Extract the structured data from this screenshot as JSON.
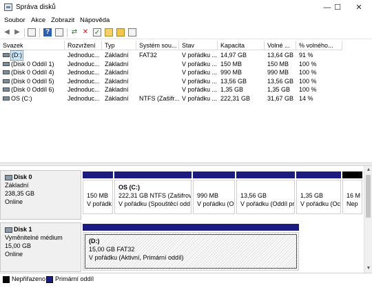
{
  "window": {
    "title": "Správa disků",
    "min": "—",
    "max": "☐",
    "close": "✕"
  },
  "menu": [
    "Soubor",
    "Akce",
    "Zobrazit",
    "Nápověda"
  ],
  "toolbar_icons": [
    "back-arrow-icon",
    "forward-arrow-icon",
    "console-tree-icon",
    "help-icon",
    "properties-icon",
    "connect-icon",
    "delete-icon",
    "check-icon",
    "new-icon",
    "open-folder-icon",
    "details-icon"
  ],
  "columns": [
    "Svazek",
    "Rozvržení",
    "Typ",
    "Systém sou...",
    "Stav",
    "Kapacita",
    "Volné ...",
    "% volného..."
  ],
  "volumes": [
    {
      "name": "(D:)",
      "layout": "Jednoduc...",
      "type": "Základní",
      "fs": "FAT32",
      "status": "V pořádku ...",
      "capacity": "14,97 GB",
      "free": "13,64 GB",
      "pct": "91 %"
    },
    {
      "name": "(Disk 0 Oddíl 1)",
      "layout": "Jednoduc...",
      "type": "Základní",
      "fs": "",
      "status": "V pořádku ...",
      "capacity": "150 MB",
      "free": "150 MB",
      "pct": "100 %"
    },
    {
      "name": "(Disk 0 Oddíl 4)",
      "layout": "Jednoduc...",
      "type": "Základní",
      "fs": "",
      "status": "V pořádku ...",
      "capacity": "990 MB",
      "free": "990 MB",
      "pct": "100 %"
    },
    {
      "name": "(Disk 0 Oddíl 5)",
      "layout": "Jednoduc...",
      "type": "Základní",
      "fs": "",
      "status": "V pořádku ...",
      "capacity": "13,56 GB",
      "free": "13,56 GB",
      "pct": "100 %"
    },
    {
      "name": "(Disk 0 Oddíl 6)",
      "layout": "Jednoduc...",
      "type": "Základní",
      "fs": "",
      "status": "V pořádku ...",
      "capacity": "1,35 GB",
      "free": "1,35 GB",
      "pct": "100 %"
    },
    {
      "name": "OS (C:)",
      "layout": "Jednoduc...",
      "type": "Základní",
      "fs": "NTFS (Zašifr...",
      "status": "V pořádku ...",
      "capacity": "222,31 GB",
      "free": "31,67 GB",
      "pct": "14 %"
    }
  ],
  "disk0": {
    "name": "Disk 0",
    "type": "Základní",
    "size": "238,35 GB",
    "state": "Online",
    "partitions": [
      {
        "title": "",
        "line1": "150 MB",
        "line2": "V pořádk"
      },
      {
        "title": "OS  (C:)",
        "line1": "222,31 GB NTFS (Zašifrová",
        "line2": "V pořádku (Spouštěcí oddí"
      },
      {
        "title": "",
        "line1": "990 MB",
        "line2": "V pořádku (O"
      },
      {
        "title": "",
        "line1": "13,56 GB",
        "line2": "V pořádku (Oddíl pr"
      },
      {
        "title": "",
        "line1": "1,35 GB",
        "line2": "V pořádku (Oc"
      },
      {
        "title": "",
        "line1": "16 M",
        "line2": "Nep"
      }
    ]
  },
  "disk1": {
    "name": "Disk 1",
    "type": "Vyměnitelné médium",
    "size": "15,00 GB",
    "state": "Online",
    "partition": {
      "title": "(D:)",
      "line1": "15,00 GB FAT32",
      "line2": "V pořádku (Aktivní, Primární oddíl)"
    }
  },
  "legend": {
    "unallocated": "Nepřiřazeno",
    "primary": "Primární oddíl"
  },
  "colors": {
    "primary": "#1c1c80",
    "unallocated": "#000000",
    "selection": "#cce8ff"
  }
}
